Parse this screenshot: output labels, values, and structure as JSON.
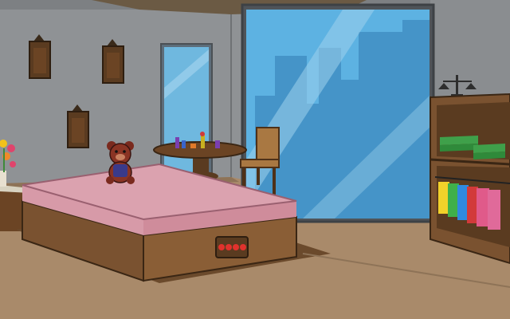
{
  "scene": {
    "room": "bedroom",
    "objects": [
      {
        "id": "wall-lamp-1",
        "icon": "wall-lamp-icon"
      },
      {
        "id": "wall-lamp-2",
        "icon": "wall-lamp-icon"
      },
      {
        "id": "wall-lamp-3",
        "icon": "wall-lamp-icon"
      },
      {
        "id": "teddy-bear",
        "icon": "teddy-bear-icon"
      },
      {
        "id": "round-table",
        "icon": "table-icon"
      },
      {
        "id": "wooden-chair",
        "icon": "chair-icon"
      },
      {
        "id": "big-window",
        "icon": "window-icon"
      },
      {
        "id": "bookshelf",
        "icon": "shelf-icon"
      },
      {
        "id": "balance-scale",
        "icon": "scale-icon"
      },
      {
        "id": "bed-code-panel",
        "icon": "code-panel-icon"
      },
      {
        "id": "flower-vase",
        "icon": "flower-icon"
      }
    ],
    "bed_code_panel": {
      "buttons": 4,
      "button_color": "#e0322d"
    },
    "colors": {
      "wall": "#8f9295",
      "floor": "#a98a6a",
      "window_sky": "#5db2e2",
      "bed_sheet": "#d79aa8",
      "wood": "#7a5230"
    }
  }
}
